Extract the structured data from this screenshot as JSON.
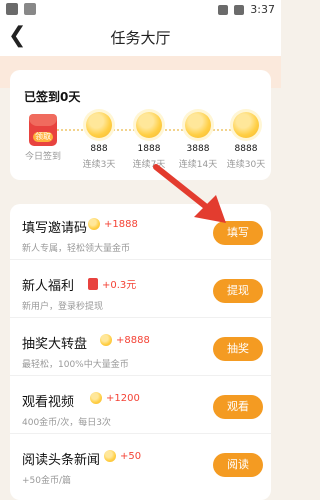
{
  "status_bar": {
    "time": "3:37"
  },
  "header": {
    "title": "任务大厅",
    "back_icon": "back-arrow-icon"
  },
  "signin": {
    "title": "已签到0天",
    "first_reward": {
      "badge": "领取",
      "label": "今日签到"
    },
    "rewards": [
      {
        "amount": "888",
        "label": "连续3天"
      },
      {
        "amount": "1888",
        "label": "连续7天"
      },
      {
        "amount": "3888",
        "label": "连续14天"
      },
      {
        "amount": "8888",
        "label": "连续30天"
      }
    ]
  },
  "tasks": [
    {
      "title": "填写邀请码",
      "reward": "+1888",
      "desc": "新人专属，轻松领大量金币",
      "button": "填写",
      "reward_icon": "coin-icon"
    },
    {
      "title": "新人福利",
      "reward": "+0.3元",
      "desc": "新用户，登录秒提现",
      "button": "提现",
      "reward_icon": "red-packet-icon"
    },
    {
      "title": "抽奖大转盘",
      "reward": "+8888",
      "desc": "最轻松，100%中大量金币",
      "button": "抽奖",
      "reward_icon": "coin-icon"
    },
    {
      "title": "观看视频",
      "reward": "+1200",
      "desc": "400金币/次，每日3次",
      "button": "观看",
      "reward_icon": "coin-icon"
    },
    {
      "title": "阅读头条新闻",
      "reward": "+50",
      "desc": "+50金币/篇",
      "button": "阅读",
      "reward_icon": "coin-icon"
    }
  ],
  "colors": {
    "accent": "#f49b22",
    "reward": "#f44336",
    "background": "#f6f1ea"
  }
}
